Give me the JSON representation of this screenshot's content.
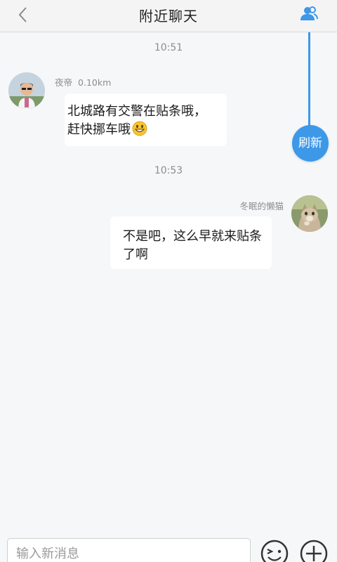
{
  "header": {
    "title": "附近聊天",
    "back_icon": "chevron-left-icon",
    "contacts_icon": "user-group-icon"
  },
  "refresh": {
    "label": "刷新",
    "color": "#3d98e8"
  },
  "messages": [
    {
      "time": "10:51",
      "sender": "夜帝",
      "distance": "0.10km",
      "line1": "北城路有交警在贴条哦，",
      "line2": "赶快挪车哦",
      "emoji": "grinning-face-emoji",
      "side": "left"
    },
    {
      "time": "10:53",
      "sender": "冬眠的懒猫",
      "line1": "不是吧，这么早就来贴条",
      "line2": "了啊",
      "side": "right"
    }
  ],
  "composer": {
    "placeholder": "输入新消息",
    "emoji_icon": "wink-face-icon",
    "plus_icon": "plus-circle-icon"
  }
}
